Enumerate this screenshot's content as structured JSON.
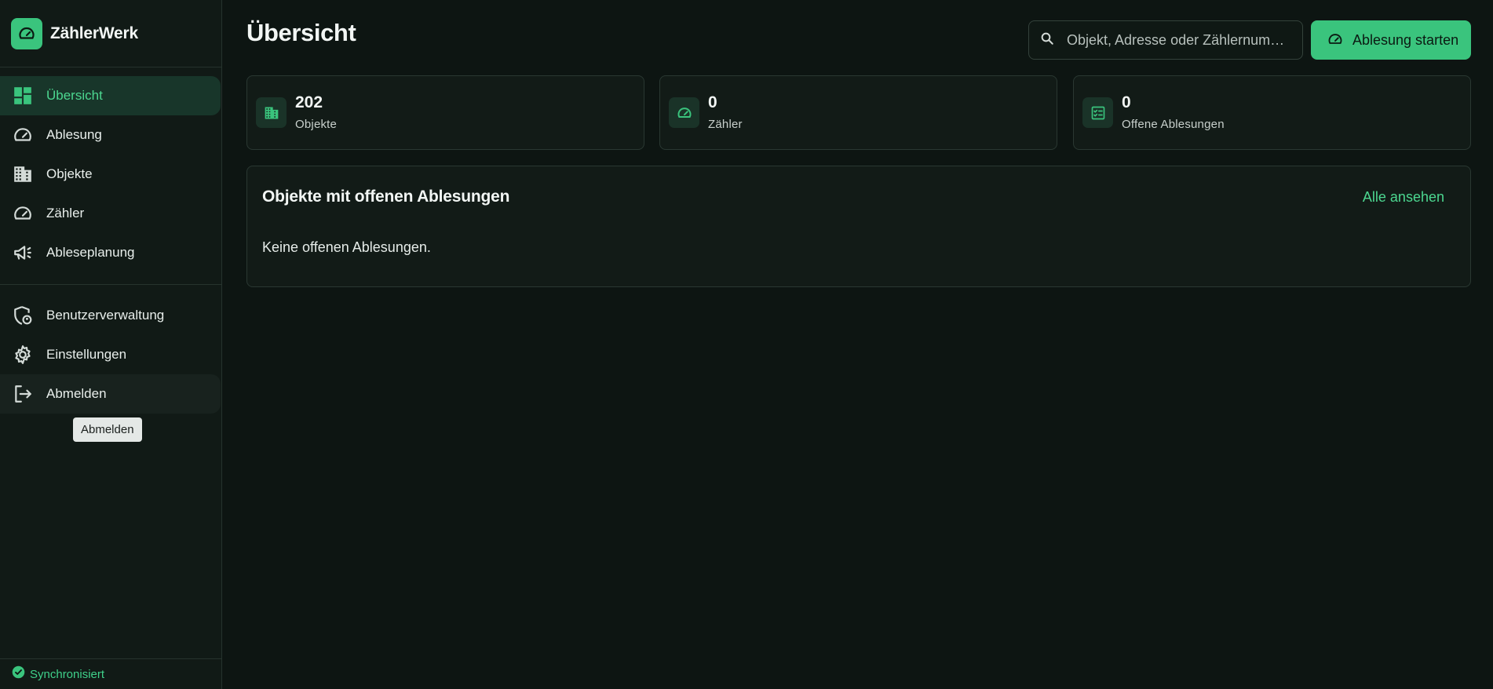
{
  "app": {
    "name": "ZählerWerk"
  },
  "colors": {
    "accent": "#3ac47d",
    "accent_text": "#4cd790",
    "background": "#0d1512",
    "sidebar": "#111a16"
  },
  "sidebar": {
    "main_items": [
      {
        "label": "Übersicht",
        "icon": "dashboard-icon",
        "active": true
      },
      {
        "label": "Ablesung",
        "icon": "gauge-icon"
      },
      {
        "label": "Objekte",
        "icon": "building-icon"
      },
      {
        "label": "Zähler",
        "icon": "meter-icon"
      },
      {
        "label": "Ableseplanung",
        "icon": "megaphone-icon"
      }
    ],
    "secondary_items": [
      {
        "label": "Benutzerverwaltung",
        "icon": "admin-shield-icon"
      },
      {
        "label": "Einstellungen",
        "icon": "gear-icon"
      },
      {
        "label": "Abmelden",
        "icon": "logout-icon",
        "hovered": true
      }
    ],
    "tooltip": "Abmelden",
    "sync_status": "Synchronisiert"
  },
  "header": {
    "title": "Übersicht",
    "search_placeholder": "Objekt, Adresse oder Zählernum…",
    "cta_label": "Ablesung starten"
  },
  "stats": [
    {
      "value": "202",
      "label": "Objekte",
      "icon": "building-icon"
    },
    {
      "value": "0",
      "label": "Zähler",
      "icon": "gauge-icon"
    },
    {
      "value": "0",
      "label": "Offene Ablesungen",
      "icon": "checklist-icon"
    }
  ],
  "panel": {
    "title": "Objekte mit offenen Ablesungen",
    "link": "Alle ansehen",
    "empty_text": "Keine offenen Ablesungen."
  }
}
